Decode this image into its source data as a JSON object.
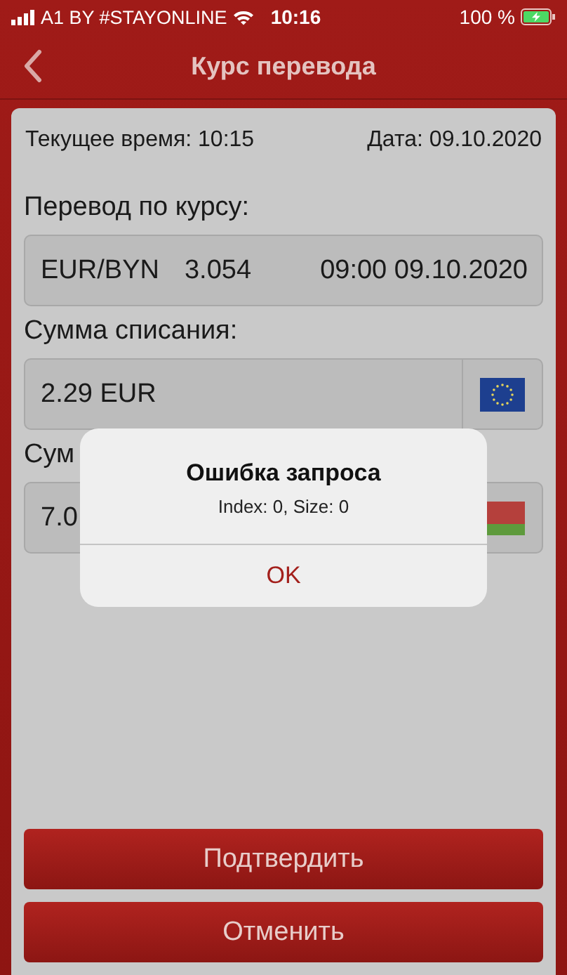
{
  "status_bar": {
    "carrier": "A1 BY #STAYONLINE",
    "time": "10:16",
    "battery": "100 %"
  },
  "nav_bar": {
    "title": "Курс перевода"
  },
  "info": {
    "time": "Текущее время:  10:15",
    "date": "Дата: 09.10.2020"
  },
  "rate": {
    "label": "Перевод по курсу:",
    "pair": "EUR/BYN",
    "value": "3.054",
    "timestamp": "09:00 09.10.2020"
  },
  "amounts": [
    {
      "label": "Сумма списания:",
      "value": "2.29 EUR",
      "kind": "eu"
    },
    {
      "label": "Сум",
      "value": "7.0",
      "kind": "by"
    }
  ],
  "buttons": [
    "Подтвердить",
    "Отменить"
  ],
  "alert": {
    "title": "Ошибка запроса",
    "message": "Index: 0, Size: 0",
    "button": "OK"
  }
}
